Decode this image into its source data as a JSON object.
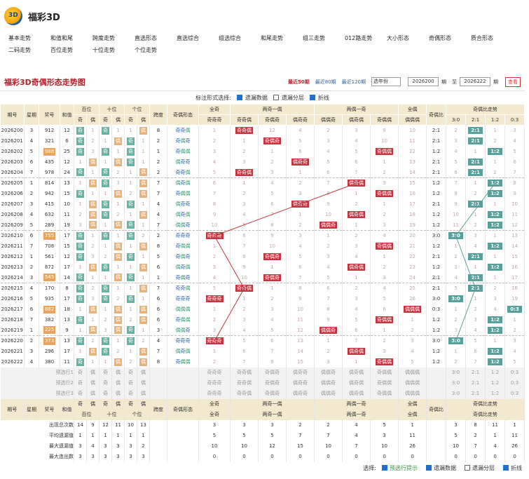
{
  "site": {
    "brand": "福彩3D",
    "logo_text": "3D"
  },
  "nav": [
    [
      "基本走势",
      "和值和尾",
      "跨度走势",
      "直选形态",
      "直选综合",
      "组选综合",
      "和尾走势",
      "组三走势",
      "012路走势",
      "大小形态",
      "奇偶形态",
      "质合形态"
    ],
    [
      "二码走势",
      "百位走势",
      "十位走势",
      "个位走势"
    ]
  ],
  "title": "福彩3D奇偶形态走势图",
  "ranges": [
    {
      "label": "最近50期",
      "active": true
    },
    {
      "label": "最近80期",
      "active": false
    },
    {
      "label": "最近120期",
      "active": false
    }
  ],
  "year_select": "选年份",
  "period_from": "2026200",
  "period_label1": "期",
  "period_to_label": "至",
  "period_to": "2026222",
  "period_label2": "期",
  "query_btn": "查看",
  "options": {
    "label": "标注形式选择:",
    "items": [
      {
        "t": "遗漏数据",
        "on": true
      },
      {
        "t": "遗漏分层",
        "on": false
      },
      {
        "t": "折线",
        "on": true
      }
    ]
  },
  "headers": {
    "period": "期号",
    "week": "星期",
    "prize": "奖号",
    "sum": "和值",
    "bai": "百位",
    "shi": "十位",
    "ge": "个位",
    "span": "跨度",
    "shape": "奇偶形态",
    "allj": "全奇",
    "twoj": "两奇一偶",
    "twoo": "两偶一奇",
    "allo": "全偶",
    "ratio": "奇偶比",
    "trend": "奇偶比走势",
    "j": "奇",
    "o": "偶",
    "pats": [
      "奇奇奇",
      "奇奇偶",
      "奇偶奇",
      "偶奇奇",
      "偶偶奇",
      "偶奇偶",
      "奇偶偶",
      "偶偶偶"
    ],
    "ratios": [
      "3:0",
      "2:1",
      "1:2",
      "0:3"
    ]
  },
  "rows": [
    {
      "p": "2026200",
      "w": "3",
      "n": "912",
      "s": "12",
      "sp": "8",
      "shape": "奇奇偶",
      "pos": 1,
      "pm": [
        1,
        0,
        12,
        4,
        2,
        3,
        9,
        10
      ],
      "rt": "2:1",
      "rm": [
        2,
        0,
        1,
        3
      ],
      "ri": 1,
      "d": [
        [
          0,
          1
        ],
        [
          1,
          0
        ],
        [
          0,
          3
        ],
        [
          1,
          0
        ],
        [
          1,
          0
        ],
        [
          0,
          1
        ]
      ]
    },
    {
      "p": "2026201",
      "w": "4",
      "n": "321",
      "s": "6",
      "sp": "2",
      "shape": "奇偶奇",
      "pos": 2,
      "pm": [
        2,
        1,
        0,
        5,
        3,
        4,
        10,
        11
      ],
      "rt": "2:1",
      "rm": [
        3,
        0,
        2,
        4
      ],
      "ri": 1,
      "d": [
        [
          0,
          2
        ],
        [
          2,
          0
        ],
        [
          1,
          0
        ],
        [
          0,
          4
        ],
        [
          0,
          1
        ],
        [
          1,
          0
        ]
      ]
    },
    {
      "p": "2026202",
      "w": "5",
      "n": "988",
      "s": "25",
      "sp": "1",
      "shape": "奇偶偶",
      "pos": 6,
      "pm": [
        3,
        2,
        1,
        6,
        4,
        5,
        0,
        12
      ],
      "rt": "1:2",
      "rm": [
        4,
        1,
        0,
        5
      ],
      "ri": 2,
      "d": [
        [
          0,
          3
        ],
        [
          3,
          0
        ],
        [
          0,
          1
        ],
        [
          1,
          0
        ],
        [
          0,
          1
        ],
        [
          1,
          0
        ]
      ],
      "big": true
    },
    {
      "p": "2026203",
      "w": "6",
      "n": "435",
      "s": "12",
      "sp": "2",
      "shape": "偶奇奇",
      "pos": 3,
      "pm": [
        4,
        3,
        2,
        0,
        5,
        6,
        1,
        13
      ],
      "rt": "2:1",
      "rm": [
        5,
        0,
        1,
        6
      ],
      "ri": 1,
      "d": [
        [
          1,
          0
        ],
        [
          0,
          1
        ],
        [
          1,
          0
        ],
        [
          0,
          2
        ],
        [
          0,
          3
        ],
        [
          1,
          0
        ]
      ]
    },
    {
      "p": "2026204",
      "w": "7",
      "n": "978",
      "s": "24",
      "sp": "2",
      "shape": "奇奇偶",
      "pos": 1,
      "pm": [
        5,
        0,
        3,
        1,
        6,
        7,
        2,
        14
      ],
      "rt": "2:1",
      "rm": [
        6,
        0,
        2,
        7
      ],
      "ri": 1,
      "d": [
        [
          0,
          1
        ],
        [
          1,
          0
        ],
        [
          0,
          1
        ],
        [
          2,
          0
        ],
        [
          1,
          0
        ],
        [
          0,
          1
        ]
      ]
    },
    {
      "p": "2026205",
      "w": "1",
      "n": "814",
      "s": "13",
      "sp": "7",
      "shape": "偶奇偶",
      "pos": 5,
      "pm": [
        6,
        1,
        4,
        2,
        7,
        0,
        3,
        15
      ],
      "rt": "1:2",
      "rm": [
        7,
        1,
        0,
        8
      ],
      "ri": 2,
      "d": [
        [
          1,
          0
        ],
        [
          0,
          2
        ],
        [
          0,
          1
        ],
        [
          3,
          0
        ],
        [
          1,
          0
        ],
        [
          0,
          2
        ]
      ]
    },
    {
      "p": "2026206",
      "w": "2",
      "n": "942",
      "s": "15",
      "sp": "7",
      "shape": "奇偶偶",
      "pos": 6,
      "pm": [
        7,
        2,
        5,
        3,
        8,
        1,
        0,
        16
      ],
      "rt": "1:2",
      "rm": [
        8,
        2,
        0,
        9
      ],
      "ri": 2,
      "d": [
        [
          0,
          1
        ],
        [
          1,
          0
        ],
        [
          1,
          0
        ],
        [
          0,
          1
        ],
        [
          2,
          0
        ],
        [
          0,
          3
        ]
      ]
    },
    {
      "p": "2026207",
      "w": "3",
      "n": "415",
      "s": "10",
      "sp": "4",
      "shape": "偶奇奇",
      "pos": 3,
      "pm": [
        8,
        3,
        6,
        0,
        9,
        2,
        1,
        17
      ],
      "rt": "2:1",
      "rm": [
        9,
        0,
        1,
        10
      ],
      "ri": 1,
      "d": [
        [
          1,
          0
        ],
        [
          0,
          3
        ],
        [
          0,
          1
        ],
        [
          1,
          0
        ],
        [
          0,
          1
        ],
        [
          1,
          0
        ]
      ]
    },
    {
      "p": "2026208",
      "w": "4",
      "n": "632",
      "s": "11",
      "sp": "4",
      "shape": "偶奇偶",
      "pos": 5,
      "pm": [
        9,
        4,
        7,
        1,
        10,
        0,
        2,
        18
      ],
      "rt": "1:2",
      "rm": [
        10,
        1,
        0,
        11
      ],
      "ri": 2,
      "d": [
        [
          2,
          0
        ],
        [
          0,
          4
        ],
        [
          0,
          2
        ],
        [
          2,
          0
        ],
        [
          1,
          0
        ],
        [
          0,
          1
        ]
      ]
    },
    {
      "p": "2026209",
      "w": "5",
      "n": "289",
      "s": "19",
      "sp": "7",
      "shape": "偶偶奇",
      "pos": 4,
      "pm": [
        10,
        5,
        8,
        2,
        0,
        1,
        3,
        19
      ],
      "rt": "1:2",
      "rm": [
        11,
        2,
        0,
        12
      ],
      "ri": 2,
      "d": [
        [
          3,
          0
        ],
        [
          0,
          5
        ],
        [
          1,
          0
        ],
        [
          0,
          1
        ],
        [
          0,
          2
        ],
        [
          1,
          0
        ]
      ]
    },
    {
      "p": "2026210",
      "w": "6",
      "n": "755",
      "s": "17",
      "sp": "2",
      "shape": "奇奇奇",
      "pos": 0,
      "pm": [
        0,
        6,
        9,
        3,
        1,
        2,
        4,
        20
      ],
      "rt": "3:0",
      "rm": [
        0,
        3,
        1,
        13
      ],
      "ri": 0,
      "d": [
        [
          0,
          1
        ],
        [
          1,
          0
        ],
        [
          0,
          1
        ],
        [
          1,
          0
        ],
        [
          0,
          3
        ],
        [
          2,
          0
        ]
      ],
      "big": true
    },
    {
      "p": "2026211",
      "w": "7",
      "n": "708",
      "s": "15",
      "sp": "8",
      "shape": "奇偶偶",
      "pos": 6,
      "pm": [
        1,
        7,
        10,
        4,
        2,
        3,
        0,
        21
      ],
      "rt": "1:2",
      "rm": [
        1,
        4,
        0,
        14
      ],
      "ri": 2,
      "d": [
        [
          0,
          2
        ],
        [
          2,
          0
        ],
        [
          1,
          0
        ],
        [
          0,
          1
        ],
        [
          1,
          0
        ],
        [
          0,
          1
        ]
      ]
    },
    {
      "p": "2026212",
      "w": "1",
      "n": "561",
      "s": "12",
      "sp": "5",
      "shape": "奇偶奇",
      "pos": 2,
      "pm": [
        2,
        8,
        0,
        5,
        3,
        4,
        1,
        22
      ],
      "rt": "2:1",
      "rm": [
        2,
        0,
        1,
        15
      ],
      "ri": 1,
      "d": [
        [
          0,
          3
        ],
        [
          3,
          0
        ],
        [
          2,
          0
        ],
        [
          0,
          1
        ],
        [
          0,
          1
        ],
        [
          1,
          0
        ]
      ]
    },
    {
      "p": "2026213",
      "w": "2",
      "n": "872",
      "s": "17",
      "sp": "6",
      "shape": "偶奇偶",
      "pos": 5,
      "pm": [
        3,
        9,
        1,
        6,
        4,
        0,
        2,
        23
      ],
      "rt": "1:2",
      "rm": [
        3,
        1,
        0,
        16
      ],
      "ri": 2,
      "d": [
        [
          1,
          0
        ],
        [
          0,
          1
        ],
        [
          0,
          1
        ],
        [
          1,
          0
        ],
        [
          1,
          0
        ],
        [
          0,
          2
        ]
      ]
    },
    {
      "p": "2026214",
      "w": "3",
      "n": "545",
      "s": "14",
      "sp": "1",
      "shape": "奇偶奇",
      "pos": 2,
      "pm": [
        4,
        10,
        0,
        7,
        5,
        1,
        3,
        24
      ],
      "rt": "2:1",
      "rm": [
        4,
        0,
        1,
        17
      ],
      "ri": 1,
      "d": [
        [
          0,
          1
        ],
        [
          1,
          0
        ],
        [
          1,
          0
        ],
        [
          0,
          1
        ],
        [
          0,
          1
        ],
        [
          1,
          0
        ]
      ],
      "big": true
    },
    {
      "p": "2026215",
      "w": "4",
      "n": "170",
      "s": "8",
      "sp": "7",
      "shape": "奇奇偶",
      "pos": 1,
      "pm": [
        5,
        0,
        1,
        8,
        6,
        2,
        4,
        25
      ],
      "rt": "2:1",
      "rm": [
        5,
        0,
        2,
        18
      ],
      "ri": 1,
      "d": [
        [
          0,
          2
        ],
        [
          2,
          0
        ],
        [
          0,
          1
        ],
        [
          1,
          0
        ],
        [
          1,
          0
        ],
        [
          0,
          1
        ]
      ]
    },
    {
      "p": "2026216",
      "w": "5",
      "n": "935",
      "s": "17",
      "sp": "6",
      "shape": "奇奇奇",
      "pos": 0,
      "pm": [
        0,
        1,
        2,
        9,
        7,
        3,
        5,
        26
      ],
      "rt": "3:0",
      "rm": [
        0,
        1,
        3,
        19
      ],
      "ri": 0,
      "d": [
        [
          0,
          3
        ],
        [
          3,
          0
        ],
        [
          0,
          1
        ],
        [
          2,
          0
        ],
        [
          0,
          1
        ],
        [
          1,
          0
        ]
      ]
    },
    {
      "p": "2026217",
      "w": "6",
      "n": "882",
      "s": "18",
      "sp": "6",
      "shape": "偶偶偶",
      "pos": 7,
      "pm": [
        1,
        2,
        3,
        10,
        8,
        4,
        6,
        0
      ],
      "rt": "0:3",
      "rm": [
        1,
        2,
        4,
        0
      ],
      "ri": 3,
      "d": [
        [
          1,
          0
        ],
        [
          0,
          1
        ],
        [
          1,
          0
        ],
        [
          0,
          1
        ],
        [
          1,
          0
        ],
        [
          0,
          1
        ]
      ],
      "big": true
    },
    {
      "p": "2026218",
      "w": "7",
      "n": "382",
      "s": "13",
      "sp": "6",
      "shape": "奇偶偶",
      "pos": 6,
      "pm": [
        2,
        3,
        4,
        11,
        9,
        5,
        0,
        1
      ],
      "rt": "1:2",
      "rm": [
        2,
        3,
        0,
        1
      ],
      "ri": 2,
      "d": [
        [
          0,
          1
        ],
        [
          1,
          0
        ],
        [
          2,
          0
        ],
        [
          0,
          1
        ],
        [
          2,
          0
        ],
        [
          0,
          2
        ]
      ]
    },
    {
      "p": "2026219",
      "w": "1",
      "n": "225",
      "s": "9",
      "sp": "3",
      "shape": "偶偶奇",
      "pos": 4,
      "pm": [
        3,
        4,
        5,
        12,
        0,
        6,
        1,
        2
      ],
      "rt": "1:2",
      "rm": [
        3,
        4,
        0,
        2
      ],
      "ri": 2,
      "d": [
        [
          1,
          0
        ],
        [
          0,
          1
        ],
        [
          3,
          0
        ],
        [
          0,
          2
        ],
        [
          0,
          1
        ],
        [
          1,
          0
        ]
      ],
      "big": true
    },
    {
      "p": "2026220",
      "w": "2",
      "n": "373",
      "s": "13",
      "sp": "4",
      "shape": "奇奇奇",
      "pos": 0,
      "pm": [
        0,
        5,
        6,
        13,
        1,
        7,
        2,
        3
      ],
      "rt": "3:0",
      "rm": [
        0,
        5,
        1,
        3
      ],
      "ri": 0,
      "d": [
        [
          0,
          2
        ],
        [
          2,
          0
        ],
        [
          0,
          1
        ],
        [
          1,
          0
        ],
        [
          0,
          1
        ],
        [
          2,
          0
        ]
      ],
      "big": true
    },
    {
      "p": "2026221",
      "w": "3",
      "n": "296",
      "s": "17",
      "sp": "7",
      "shape": "偶奇偶",
      "pos": 5,
      "pm": [
        1,
        6,
        7,
        14,
        2,
        0,
        3,
        4
      ],
      "rt": "1:2",
      "rm": [
        1,
        6,
        0,
        4
      ],
      "ri": 2,
      "d": [
        [
          1,
          0
        ],
        [
          0,
          3
        ],
        [
          0,
          2
        ],
        [
          2,
          0
        ],
        [
          1,
          0
        ],
        [
          0,
          1
        ]
      ]
    },
    {
      "p": "2026222",
      "w": "4",
      "n": "380",
      "s": "11",
      "sp": "8",
      "shape": "奇偶偶",
      "pos": 6,
      "pm": [
        2,
        7,
        8,
        15,
        3,
        1,
        0,
        5
      ],
      "rt": "1:2",
      "rm": [
        2,
        7,
        0,
        5
      ],
      "ri": 2,
      "d": [
        [
          0,
          1
        ],
        [
          1,
          0
        ],
        [
          1,
          0
        ],
        [
          0,
          1
        ],
        [
          2,
          0
        ],
        [
          0,
          2
        ]
      ]
    }
  ],
  "preview_rows": [
    "预选行1",
    "预选行2",
    "预选行3"
  ],
  "stats": [
    {
      "label": "出现总次数",
      "v": [
        "14",
        "9",
        "12",
        "11",
        "10",
        "13"
      ],
      "pm": [
        "3",
        "3",
        "3",
        "2",
        "2",
        "4",
        "5",
        "1"
      ],
      "rm": [
        "3",
        "8",
        "11",
        "1"
      ]
    },
    {
      "label": "平均遗漏值",
      "v": [
        "1",
        "1",
        "1",
        "1",
        "1",
        "1"
      ],
      "pm": [
        "5",
        "5",
        "5",
        "7",
        "7",
        "4",
        "3",
        "11"
      ],
      "rm": [
        "5",
        "2",
        "1",
        "11"
      ]
    },
    {
      "label": "最大遗漏值",
      "v": [
        "3",
        "4",
        "3",
        "3",
        "3",
        "2"
      ],
      "pm": [
        "10",
        "10",
        "12",
        "15",
        "10",
        "7",
        "10",
        "26"
      ],
      "rm": [
        "10",
        "7",
        "4",
        "26"
      ]
    },
    {
      "label": "最大连出数",
      "v": [
        "3",
        "3",
        "3",
        "3",
        "3",
        "3"
      ],
      "pm": [
        "0",
        "0",
        "0",
        "0",
        "0",
        "0",
        "0",
        "0"
      ],
      "rm": [
        "0",
        "0",
        "0",
        "0"
      ]
    }
  ],
  "footer": {
    "label": "选择:",
    "items": [
      {
        "t": "预选行提示",
        "on": true,
        "green": true
      },
      {
        "t": "遗漏数据",
        "on": true
      },
      {
        "t": "遗漏分层",
        "on": false
      },
      {
        "t": "折线",
        "on": true
      }
    ]
  },
  "colors": {
    "title": "#b2202a",
    "hit_pattern": "#c33440",
    "hit_ratio": "#57a09b",
    "odd_ball": "#64b4a4",
    "even_ball": "#e8b07a",
    "header_bg": "#f3e9cf"
  }
}
